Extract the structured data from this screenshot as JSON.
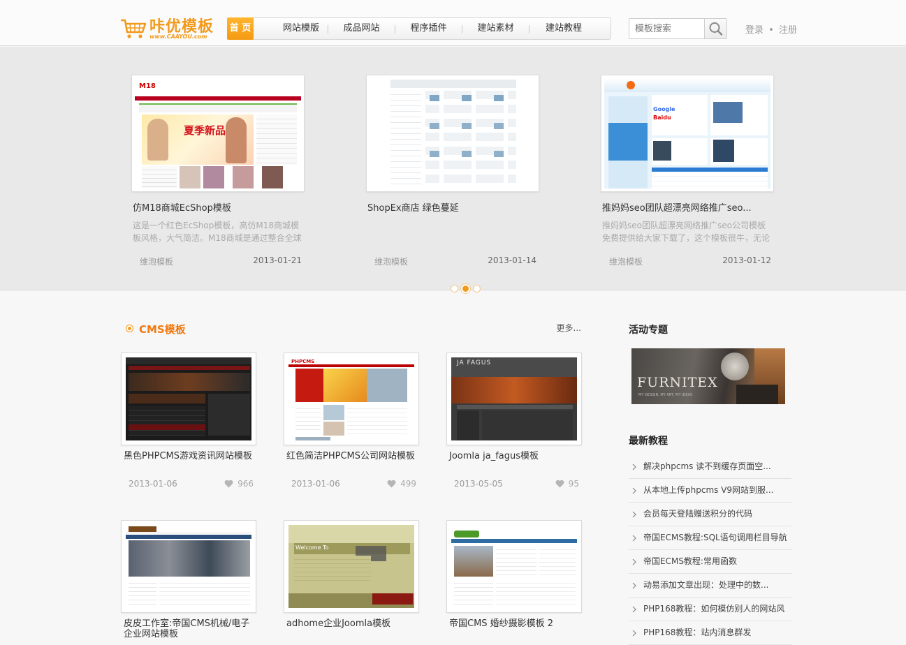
{
  "header": {
    "logo_text": "咔优模板",
    "logo_sub": "www.CAAYOU.com",
    "nav": [
      "首 页",
      "网站模版",
      "成品网站",
      "程序插件",
      "建站素材",
      "建站教程"
    ],
    "active_nav_index": 0,
    "search_placeholder": "模板搜索",
    "login": "登录",
    "separator": "•",
    "register": "注册"
  },
  "slider": {
    "slides": [
      {
        "title": "仿M18商城EcShop模板",
        "desc": "这是一个红色EcShop模板，高仿M18商城模板风格，大气简洁。M18商城是通过整合全球",
        "category": "维泡模板",
        "date": "2013-01-21"
      },
      {
        "title": "ShopEx商店 绿色蔓延",
        "desc": "",
        "category": "维泡模板",
        "date": "2013-01-14"
      },
      {
        "title": "推妈妈seo团队超漂亮网络推广seo...",
        "desc": "推妈妈seo团队超漂亮网络推广seo公司模板免费提供给大家下载了，这个模板很牛，无论",
        "category": "维泡模板",
        "date": "2013-01-12"
      }
    ],
    "active_dot": 1,
    "dot_count": 3,
    "thumb_texts": {
      "m18_logo": "M18",
      "m18_banner": "夏季新品",
      "baidu": "Baidu",
      "google": "Google"
    }
  },
  "cms": {
    "title": "CMS模板",
    "more": "更多...",
    "cards": [
      {
        "title": "黑色PHPCMS游戏资讯网站模板",
        "date": "2013-01-06",
        "likes": "966"
      },
      {
        "title": "红色简洁PHPCMS公司网站模板",
        "date": "2013-01-06",
        "likes": "499"
      },
      {
        "title": "Joomla ja_fagus模板",
        "date": "2013-05-05",
        "likes": "95"
      },
      {
        "title": "皮皮工作室:帝国CMS机械/电子企业网站模板",
        "date": "",
        "likes": ""
      },
      {
        "title": "adhome企业Joomla模板",
        "date": "",
        "likes": ""
      },
      {
        "title": "帝国CMS 婚纱摄影模板 2",
        "date": "",
        "likes": ""
      }
    ],
    "thumb_texts": {
      "phpcms": "PHPCMS",
      "jafagus": "JA FAGUS",
      "welcome": "Welcome To"
    }
  },
  "sidebar": {
    "activity_title": "活动专题",
    "banner_text": "FURNITEX",
    "banner_sub": "MY DESIGN, MY ART, MY IDEAS",
    "tutorials_title": "最新教程",
    "tutorials": [
      "解决phpcms 读不到缓存页面空...",
      "从本地上传phpcms V9网站到服...",
      "会员每天登陆赠送积分的代码",
      "帝国ECMS教程:SQL语句调用栏目导航",
      "帝国ECMS教程:常用函数",
      "动易添加文章出现：处理中的数...",
      "PHP168教程：如何模仿别人的网站风",
      "PHP168教程：站内消息群发"
    ]
  },
  "colors": {
    "accent": "#f29a1c",
    "section_title": "#f07a12"
  }
}
